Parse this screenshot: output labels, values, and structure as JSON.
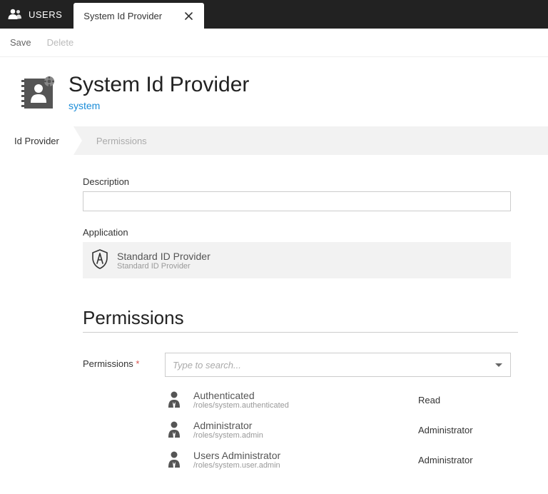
{
  "topbar": {
    "app_label": "USERS",
    "tab_title": "System Id Provider"
  },
  "actions": {
    "save": "Save",
    "delete": "Delete"
  },
  "header": {
    "title": "System Id Provider",
    "subtitle": "system"
  },
  "wizard": {
    "step1": "Id Provider",
    "step2": "Permissions"
  },
  "fields": {
    "description_label": "Description",
    "application_label": "Application",
    "application": {
      "name": "Standard ID Provider",
      "sub": "Standard ID Provider"
    }
  },
  "section": {
    "permissions_title": "Permissions"
  },
  "permissions": {
    "label": "Permissions",
    "search_placeholder": "Type to search...",
    "entries": [
      {
        "name": "Authenticated",
        "path": "/roles/system.authenticated",
        "role": "Read"
      },
      {
        "name": "Administrator",
        "path": "/roles/system.admin",
        "role": "Administrator"
      },
      {
        "name": "Users Administrator",
        "path": "/roles/system.user.admin",
        "role": "Administrator"
      }
    ]
  }
}
